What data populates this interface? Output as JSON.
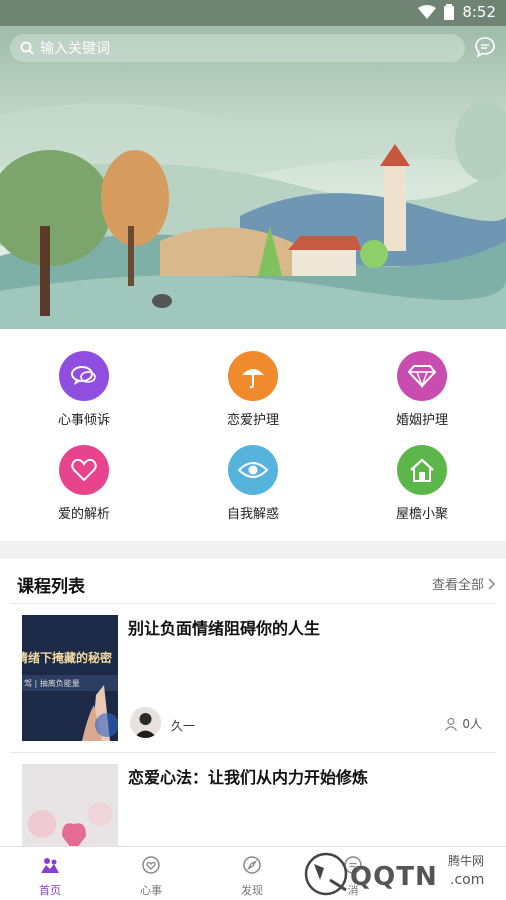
{
  "status_bar": {
    "time": "8:52"
  },
  "search": {
    "placeholder": "输入关键词"
  },
  "categories": [
    {
      "label": "心事倾诉",
      "color": "#8f4ee0",
      "icon": "chat-bubbles-icon"
    },
    {
      "label": "恋爱护理",
      "color": "#f08a2c",
      "icon": "umbrella-icon"
    },
    {
      "label": "婚姻护理",
      "color": "#c94db0",
      "icon": "diamond-icon"
    },
    {
      "label": "爱的解析",
      "color": "#e8438d",
      "icon": "heart-icon"
    },
    {
      "label": "自我解惑",
      "color": "#56b3dd",
      "icon": "eye-icon"
    },
    {
      "label": "屋檐小聚",
      "color": "#5db64a",
      "icon": "house-icon"
    }
  ],
  "course_section": {
    "title": "课程列表",
    "see_all": "查看全部"
  },
  "courses": [
    {
      "title": "别让负面情绪阻碍你的人生",
      "author": "久一",
      "count": "0人",
      "thumb_text": "情绪下掩藏的秘密",
      "thumb_subtext": "驾 | 抽离负能量"
    },
    {
      "title": "恋爱心法：让我们从内力开始修炼"
    }
  ],
  "bottom_nav": [
    {
      "label": "首页",
      "icon": "home-people-icon",
      "active": true
    },
    {
      "label": "心事",
      "icon": "heart-chat-icon",
      "active": false
    },
    {
      "label": "发现",
      "icon": "compass-icon",
      "active": false
    },
    {
      "label": "消",
      "icon": "message-icon",
      "active": false
    }
  ],
  "watermark": {
    "brand": "QQTN",
    "suffix": ".com",
    "site": "腾牛网"
  },
  "colors": {
    "active_nav": "#8a3fd4",
    "status_bar": "#6f8472"
  }
}
